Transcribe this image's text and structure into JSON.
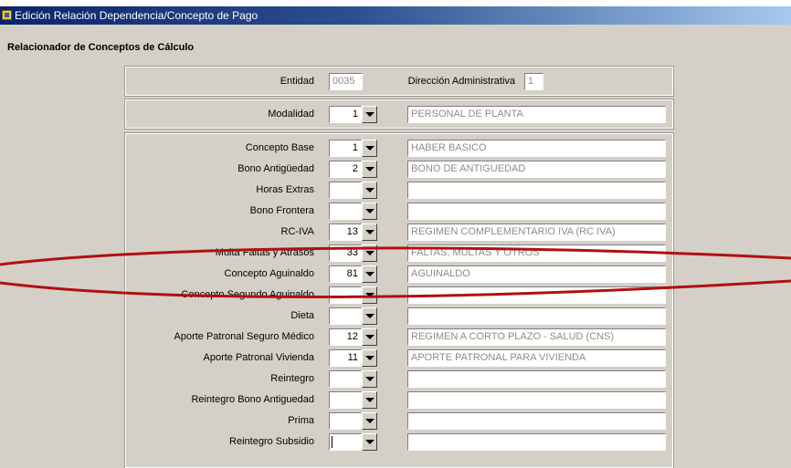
{
  "window": {
    "title": "Edición Relación Dependencia/Concepto de Pago"
  },
  "section_title": "Relacionador de Conceptos de Cálculo",
  "header": {
    "entidad_label": "Entidad",
    "entidad_value": "0035",
    "direccion_label": "Dirección Administrativa",
    "direccion_value": "1"
  },
  "modalidad": {
    "label": "Modalidad",
    "code": "1",
    "description": "PERSONAL DE PLANTA"
  },
  "conceptos": [
    {
      "label": "Concepto Base",
      "code": "1",
      "description": "HABER BASICO"
    },
    {
      "label": "Bono Antigüedad",
      "code": "2",
      "description": "BONO DE ANTIGUEDAD"
    },
    {
      "label": "Horas Extras",
      "code": "",
      "description": ""
    },
    {
      "label": "Bono Frontera",
      "code": "",
      "description": ""
    },
    {
      "label": "RC-IVA",
      "code": "13",
      "description": "REGIMEN COMPLEMENTARIO IVA (RC IVA)"
    },
    {
      "label": "Multa Faltas y Atrasos",
      "code": "33",
      "description": "FALTAS, MULTAS Y OTROS"
    },
    {
      "label": "Concepto Aguinaldo",
      "code": "81",
      "description": "AGUINALDO"
    },
    {
      "label": "Concepto Segundo Aguinaldo",
      "code": "",
      "description": ""
    },
    {
      "label": "Dieta",
      "code": "",
      "description": ""
    },
    {
      "label": "Aporte Patronal Seguro Médico",
      "code": "12",
      "description": "REGIMEN A CORTO PLAZO - SALUD (CNS)"
    },
    {
      "label": "Aporte Patronal Vivienda",
      "code": "11",
      "description": "APORTE PATRONAL PARA VIVIENDA"
    },
    {
      "label": "Reintegro",
      "code": "",
      "description": ""
    },
    {
      "label": "Reintegro Bono Antiguedad",
      "code": "",
      "description": ""
    },
    {
      "label": "Prima",
      "code": "",
      "description": ""
    },
    {
      "label": "Reintegro Subsidio",
      "code": "",
      "description": ""
    }
  ],
  "icons": {
    "window_icon": "forms-app-icon",
    "dropdown_icon": "chevron-down-icon"
  },
  "colors": {
    "titlebar": "#0a246a",
    "background": "#d4d0c8",
    "annotation": "#b01010",
    "readonly_text": "#8c8c8c"
  }
}
